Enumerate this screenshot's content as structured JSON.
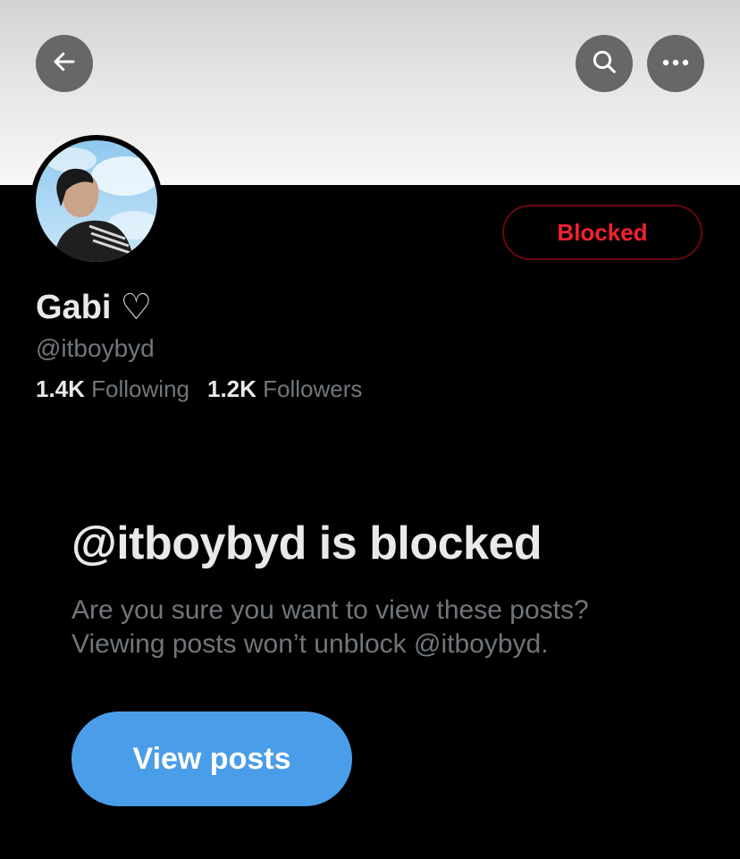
{
  "header": {
    "back_icon": "arrow-left-icon",
    "search_icon": "search-icon",
    "more_icon": "more-horizontal-icon"
  },
  "profile": {
    "name": "Gabi",
    "name_suffix": "♡",
    "handle": "@itboybyd",
    "blocked_label": "Blocked",
    "following_count": "1.4K",
    "following_label": "Following",
    "followers_count": "1.2K",
    "followers_label": "Followers"
  },
  "blocked_notice": {
    "title": "@itboybyd is blocked",
    "description_line1": "Are you sure you want to view these posts?",
    "description_line2": "Viewing posts won’t unblock @itboybyd.",
    "button_label": "View posts"
  },
  "colors": {
    "background": "#000000",
    "blocked_red": "#f4212e",
    "accent_blue": "#4a9de8",
    "secondary_text": "#71767b",
    "primary_text": "#e7e9ea"
  }
}
